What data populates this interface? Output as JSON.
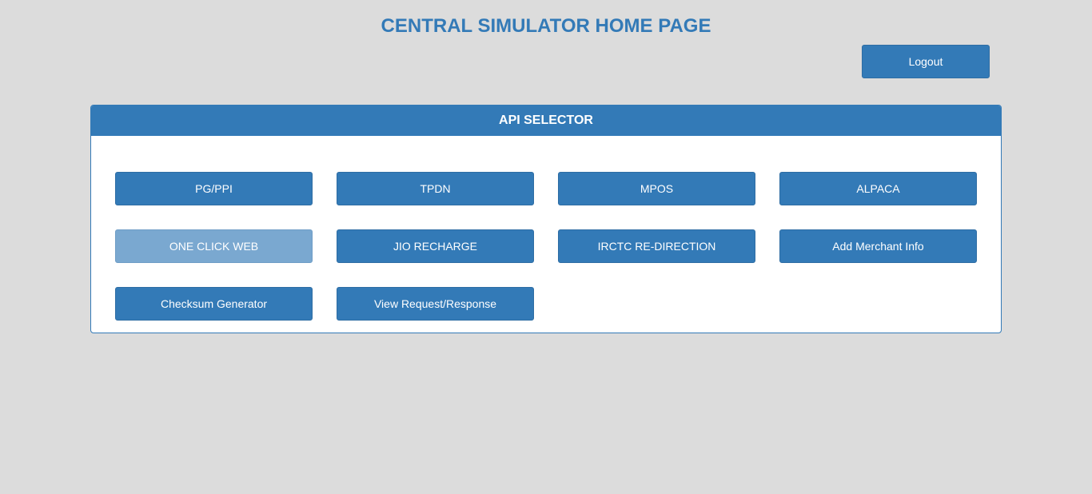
{
  "header": {
    "title": "CENTRAL SIMULATOR HOME PAGE",
    "logout_label": "Logout"
  },
  "panel": {
    "title": "API SELECTOR",
    "buttons": [
      {
        "label": "PG/PPI"
      },
      {
        "label": "TPDN"
      },
      {
        "label": "MPOS"
      },
      {
        "label": "ALPACA"
      },
      {
        "label": "ONE CLICK WEB",
        "disabled": true
      },
      {
        "label": "JIO RECHARGE"
      },
      {
        "label": "IRCTC RE-DIRECTION"
      },
      {
        "label": "Add Merchant Info"
      },
      {
        "label": "Checksum Generator"
      },
      {
        "label": "View Request/Response"
      }
    ]
  },
  "colors": {
    "primary": "#337ab7",
    "disabled": "#7aa8d0",
    "background": "#dcdcdc"
  }
}
